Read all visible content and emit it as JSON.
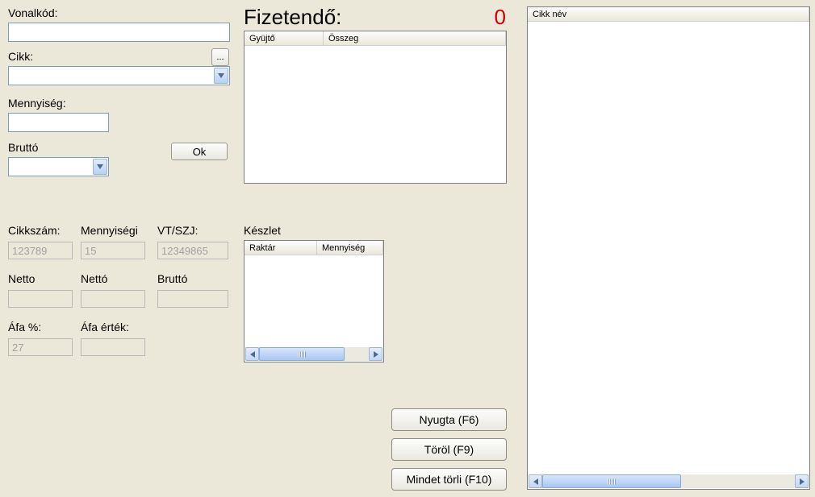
{
  "left": {
    "barcode_label": "Vonalkód:",
    "barcode_value": "",
    "item_label": "Cikk:",
    "item_value": "",
    "browse_label": "...",
    "qty_label": "Mennyiség:",
    "qty_value": "",
    "brutto_label": "Bruttó",
    "brutto_value": "",
    "ok_label": "Ok"
  },
  "details": {
    "cikkszam_label": "Cikkszám:",
    "cikkszam_value": "123789",
    "mennyisegi_label": "Mennyiségi",
    "mennyisegi_value": "15",
    "vtszj_label": "VT/SZJ:",
    "vtszj_value": "12349865",
    "netto1_label": "Netto",
    "netto1_value": "",
    "netto2_label": "Nettó",
    "netto2_value": "",
    "brutto2_label": "Bruttó",
    "brutto2_value": "",
    "afapct_label": "Áfa %:",
    "afapct_value": "27",
    "afaertek_label": "Áfa érték:",
    "afaertek_value": ""
  },
  "fizetendo": {
    "label": "Fizetendő:",
    "value": "0",
    "col_gyujto": "Gyüjtő",
    "col_osszeg": "Összeg"
  },
  "keszlet": {
    "label": "Készlet",
    "col_raktar": "Raktár",
    "col_mennyiseg": "Mennyiség"
  },
  "buttons": {
    "nyugta": "Nyugta (F6)",
    "torol": "Töröl (F9)",
    "mindet": "Mindet törli (F10)"
  },
  "right": {
    "col_cikknev": "Cikk név"
  }
}
